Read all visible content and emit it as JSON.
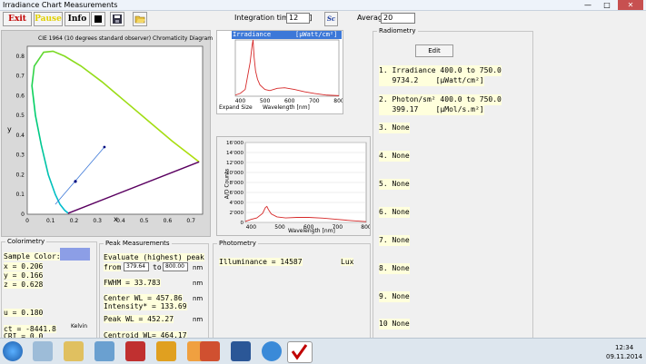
{
  "window": {
    "title": "Irradiance Chart Measurements",
    "minimize": "—",
    "maximize": "□",
    "close": "✕"
  },
  "toolbar": {
    "exit": "Exit",
    "pause": "Pause",
    "info": "Info",
    "integration_label": "Integration time [ms]",
    "integration_value": "12",
    "fit_label": "Sc",
    "average_label": "Average:",
    "average_value": "20"
  },
  "cie": {
    "title": "CIE 1964 (10 degrees standard observer) Chromaticity Diagram",
    "xlabel": "x",
    "ylabel": "y",
    "xticks": [
      "0",
      "0.1",
      "0.2",
      "0.3",
      "0.4",
      "0.5",
      "0.6",
      "0.7"
    ],
    "yticks": [
      "0",
      "0.1",
      "0.2",
      "0.3",
      "0.4",
      "0.5",
      "0.6",
      "0.7",
      "0.8"
    ]
  },
  "irradiance": {
    "header_title": "Irradiance",
    "header_unit": "[µWatt/cm²]",
    "xlabel": "Wavelength [nm]",
    "xticks": [
      "400",
      "500",
      "600",
      "700",
      "800"
    ],
    "expand_label": "Expand Size"
  },
  "counts": {
    "ylabel": "A/D Counts",
    "xlabel": "Wavelength [nm]",
    "yticks": [
      "16'000",
      "14'000",
      "12'000",
      "10'000",
      "8'000",
      "6'000",
      "4'000",
      "2'000",
      "0"
    ],
    "xticks": [
      "400",
      "500",
      "600",
      "700",
      "800"
    ]
  },
  "radiometry": {
    "title": "Radiometry",
    "edit_label": "Edit",
    "items": [
      {
        "line1": "1. Irradiance 400.0 to 750.0",
        "line2": "   9734.2    [µWatt/cm²]"
      },
      {
        "line1": "2. Photon/sm² 400.0 to 750.0",
        "line2": "   399.17    [µMol/s.m²]"
      },
      {
        "line1": "3. None"
      },
      {
        "line1": "4. None"
      },
      {
        "line1": "5. None"
      },
      {
        "line1": "6. None"
      },
      {
        "line1": "7. None"
      },
      {
        "line1": "8. None"
      },
      {
        "line1": "9. None"
      },
      {
        "line1": "10 None"
      }
    ]
  },
  "colorimetry": {
    "title": "Colorimetry",
    "sample_label": "Sample Color:",
    "sample_color": "#8c9ee6",
    "x": "x = 0.206",
    "y": "y = 0.166",
    "z": "z = 0.628",
    "u": "u = 0.180",
    "ct": "ct = -8441.8",
    "ct_unit": "Kelvin",
    "cri": "CRI = 0.0"
  },
  "peak": {
    "title": "Peak Measurements",
    "evaluate": "Evaluate (highest) peak",
    "from_label": "from",
    "from_value": "379.64",
    "to_label": "to",
    "to_value": "800.00",
    "unit": "nm",
    "fwhm": "FWHM      = 33.783",
    "center": "Center WL  = 457.86",
    "intensity": "Intensity* = 133.69",
    "peak_wl": "Peak WL    = 452.27",
    "centroid": "Centroid WL= 464.17"
  },
  "photometry": {
    "title": "Photometry",
    "illuminance": "Illuminance       = 14587",
    "unit": "Lux"
  },
  "taskbar": {
    "time": "12:34",
    "date": "09.11.2014"
  },
  "colors": {
    "accent": "#3c78d8",
    "plot_line": "#d62828",
    "locus": "#0000a0"
  }
}
